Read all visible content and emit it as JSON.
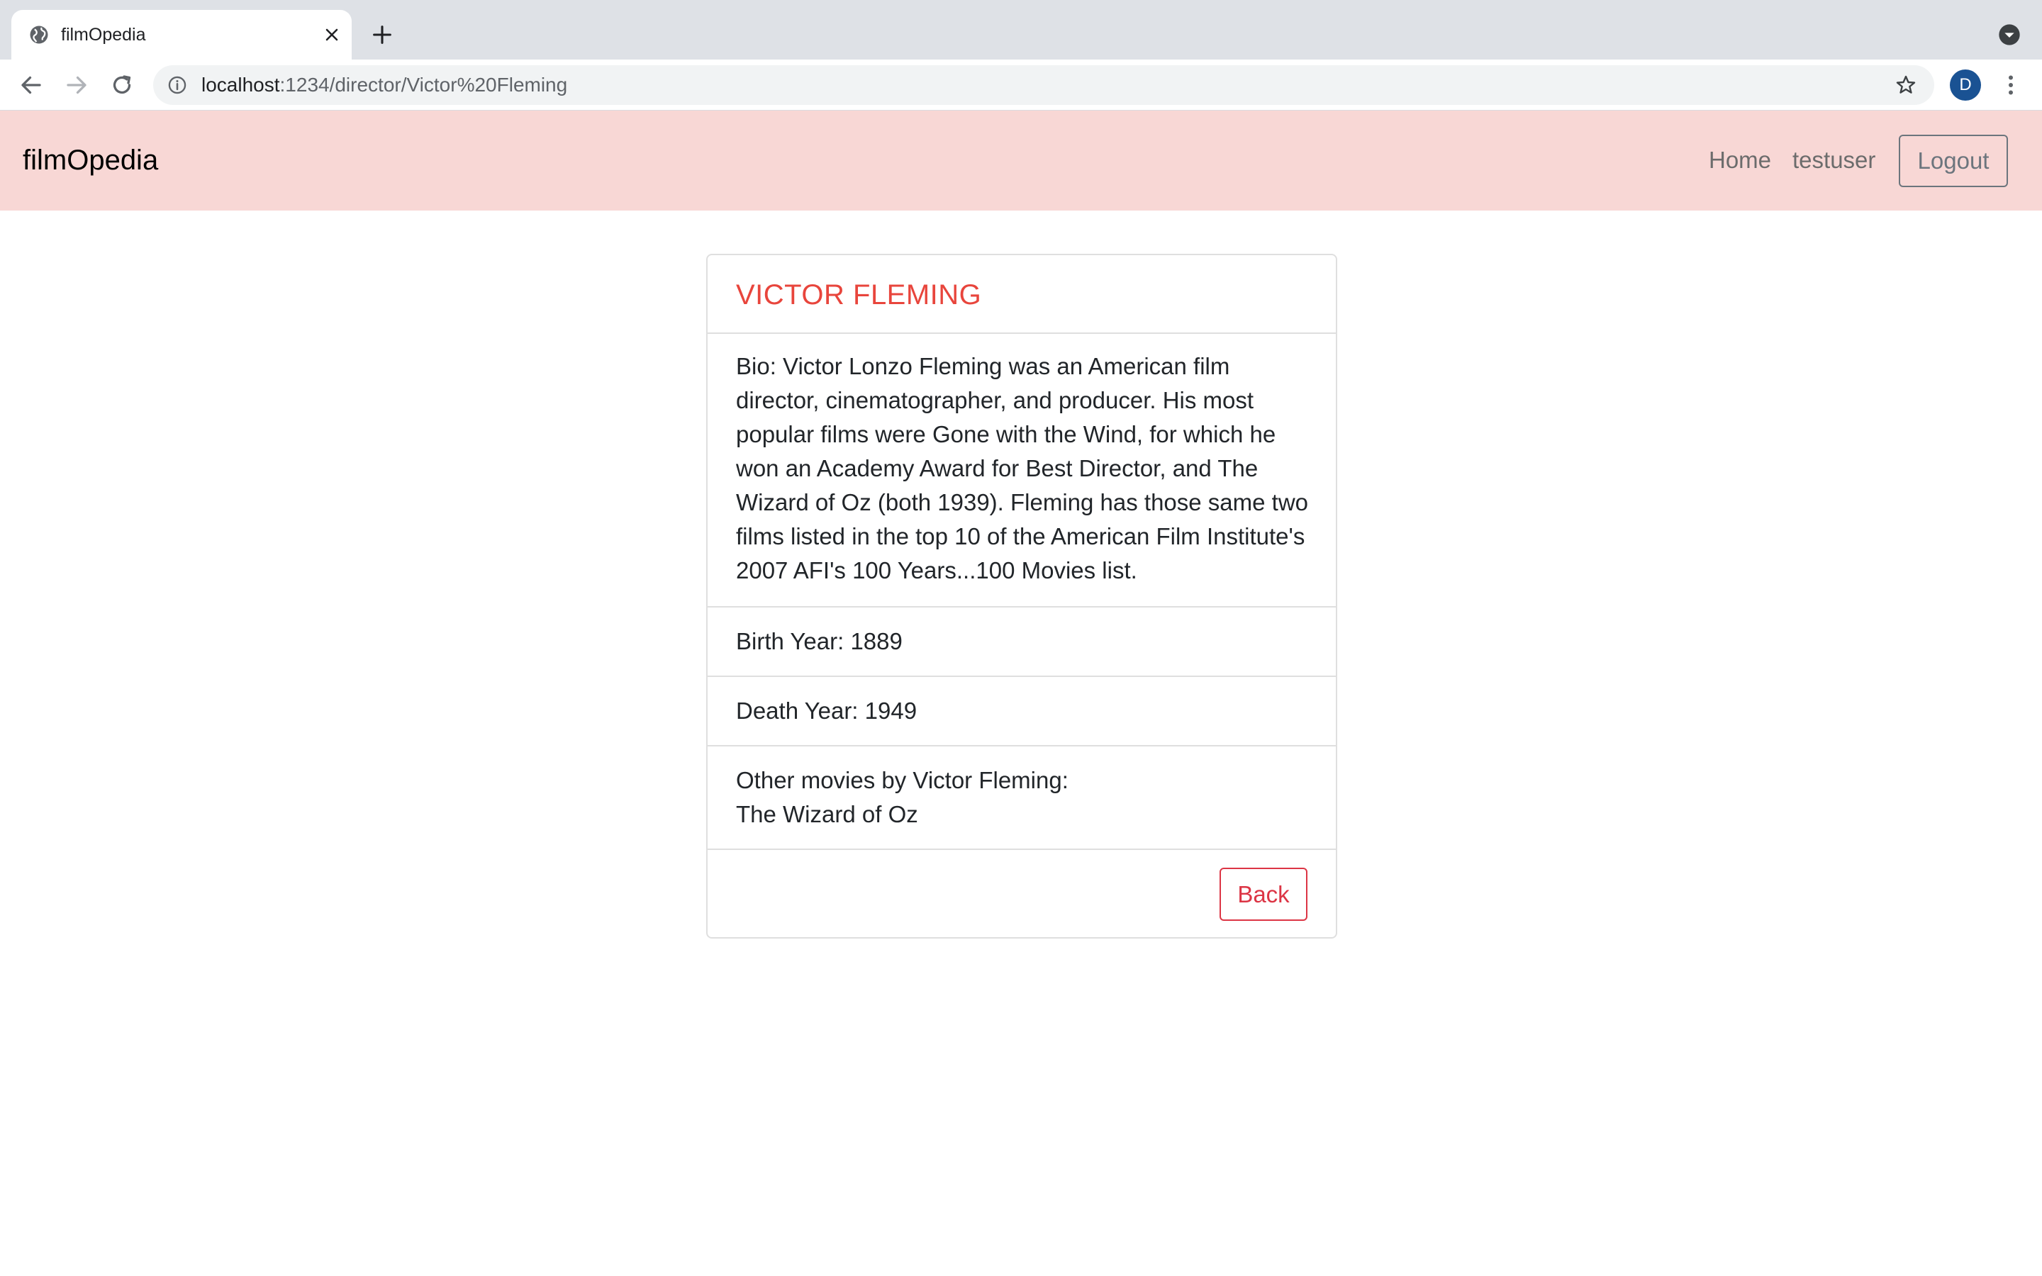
{
  "browser": {
    "tab_title": "filmOpedia",
    "url_host": "localhost",
    "url_path": ":1234/director/Victor%20Fleming",
    "profile_initial": "D"
  },
  "navbar": {
    "brand": "filmOpedia",
    "links": [
      {
        "label": "Home"
      },
      {
        "label": "testuser"
      }
    ],
    "logout_label": "Logout"
  },
  "director": {
    "name": "VICTOR FLEMING",
    "bio": "Bio: Victor Lonzo Fleming was an American film director, cinematographer, and producer. His most popular films were Gone with the Wind, for which he won an Academy Award for Best Director, and The Wizard of Oz (both 1939). Fleming has those same two films listed in the top 10 of the American Film Institute's 2007 AFI's 100 Years...100 Movies list.",
    "birth": "Birth Year: 1889",
    "death": "Death Year: 1949",
    "other_movies_heading": "Other movies by Victor Fleming:",
    "other_movies": [
      "The Wizard of Oz"
    ],
    "back_label": "Back"
  },
  "colors": {
    "navbar_bg": "#f8d7d5",
    "title_red": "#e8453c",
    "back_red": "#dc3545",
    "avatar_blue": "#1a5293"
  }
}
